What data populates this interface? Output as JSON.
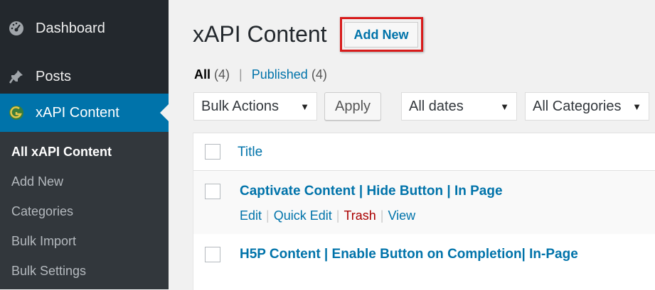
{
  "sidebar": {
    "dashboard": "Dashboard",
    "posts": "Posts",
    "xapi": "xAPI Content",
    "submenu": [
      "All xAPI Content",
      "Add New",
      "Categories",
      "Bulk Import",
      "Bulk Settings"
    ]
  },
  "main": {
    "title": "xAPI Content",
    "add_new": "Add New",
    "filters": {
      "all_label": "All",
      "all_count": "(4)",
      "separator": "|",
      "published_label": "Published",
      "published_count": "(4)"
    },
    "bulk_actions": "Bulk Actions",
    "apply": "Apply",
    "dates": "All dates",
    "categories": "All Categories",
    "table": {
      "column_title": "Title",
      "rows": [
        {
          "title": "Captivate Content | Hide Button | In Page"
        },
        {
          "title": "H5P Content | Enable Button on Completion| In-Page"
        }
      ],
      "row_actions": {
        "edit": "Edit",
        "quick_edit": "Quick Edit",
        "trash": "Trash",
        "view": "View",
        "sep": "|"
      }
    }
  },
  "colors": {
    "accent": "#0073aa",
    "highlight": "#d81b1b",
    "sidebar": "#23282d"
  }
}
